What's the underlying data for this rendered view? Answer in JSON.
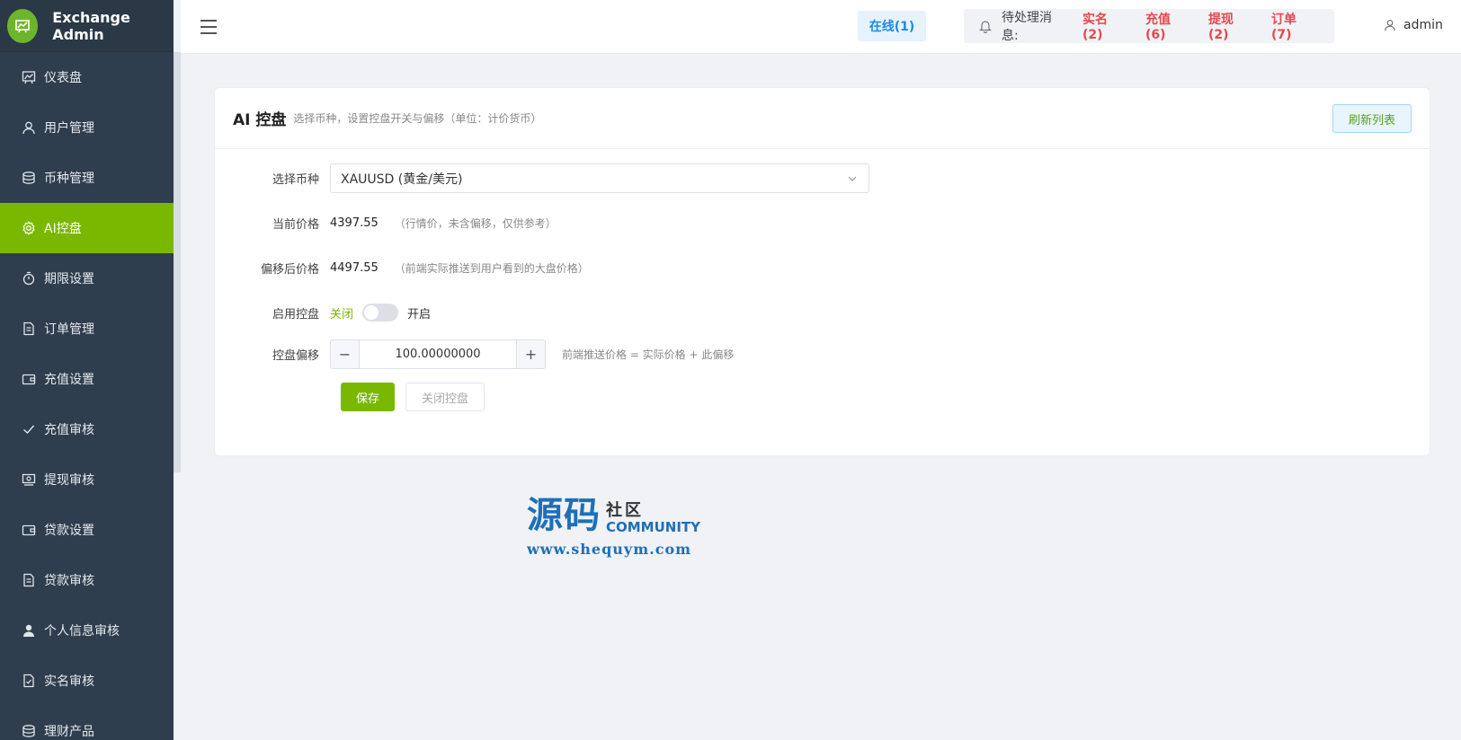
{
  "brand": {
    "title": "Exchange Admin"
  },
  "sidebar": {
    "items": [
      {
        "label": "仪表盘",
        "icon": "dashboard-icon",
        "active": false
      },
      {
        "label": "用户管理",
        "icon": "user-icon",
        "active": false
      },
      {
        "label": "币种管理",
        "icon": "coins-icon",
        "active": false
      },
      {
        "label": "AI控盘",
        "icon": "gear-icon",
        "active": true
      },
      {
        "label": "期限设置",
        "icon": "timer-icon",
        "active": false
      },
      {
        "label": "订单管理",
        "icon": "document-icon",
        "active": false
      },
      {
        "label": "充值设置",
        "icon": "wallet-icon",
        "active": false
      },
      {
        "label": "充值审核",
        "icon": "check-icon",
        "active": false
      },
      {
        "label": "提现审核",
        "icon": "money-icon",
        "active": false
      },
      {
        "label": "贷款设置",
        "icon": "wallet-icon",
        "active": false
      },
      {
        "label": "贷款审核",
        "icon": "document-icon",
        "active": false
      },
      {
        "label": "个人信息审核",
        "icon": "person-icon",
        "active": false
      },
      {
        "label": "实名审核",
        "icon": "doc-check-icon",
        "active": false
      },
      {
        "label": "理财产品",
        "icon": "coins-icon",
        "active": false
      }
    ]
  },
  "header": {
    "online": "在线(1)",
    "pending_label": "待处理消息:",
    "pending": [
      "实名(2)",
      "充值(6)",
      "提现(2)",
      "订单(7)"
    ],
    "user": "admin"
  },
  "card": {
    "title": "AI 控盘",
    "subtitle": "选择币种，设置控盘开关与偏移（单位：计价货币）",
    "refresh_button": "刷新列表"
  },
  "form": {
    "symbol_label": "选择币种",
    "symbol_value": "XAUUSD (黄金/美元)",
    "current_price_label": "当前价格",
    "current_price": "4397.55",
    "current_price_hint": "（行情价，未含偏移，仅供参考）",
    "offset_price_label": "偏移后价格",
    "offset_price": "4497.55",
    "offset_price_hint": "（前端实际推送到用户看到的大盘价格）",
    "enable_label": "启用控盘",
    "off_text": "关闭",
    "on_text": "开启",
    "enabled": false,
    "offset_label": "控盘偏移",
    "offset_value": "100.00000000",
    "offset_hint": "前端推送价格 = 实际价格 + 此偏移",
    "save_button": "保存",
    "close_button": "关闭控盘"
  },
  "watermark": {
    "main": "源码",
    "cn": "社区",
    "en": "COMMUNITY",
    "url": "www.shequym.com"
  },
  "colors": {
    "accent": "#7ab800",
    "sidebar_bg": "#2f3e4e",
    "danger": "#e5484d",
    "info": "#1e88e5"
  }
}
